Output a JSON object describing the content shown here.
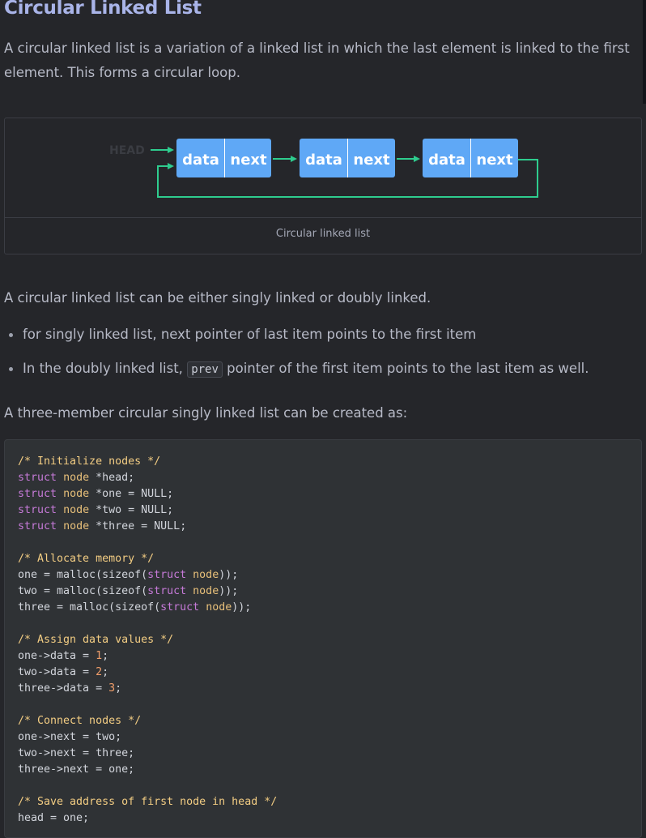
{
  "article": {
    "title": "Circular Linked List",
    "intro": "A circular linked list is a variation of a linked list in which the last element is linked to the first element. This forms a circular loop.",
    "figure": {
      "head_label": "HEAD",
      "nodes": [
        {
          "data": "data",
          "next": "next"
        },
        {
          "data": "data",
          "next": "next"
        },
        {
          "data": "data",
          "next": "next"
        }
      ],
      "caption": "Circular linked list"
    },
    "either_text": "A circular linked list can be either singly linked or doubly linked.",
    "bullets": {
      "b1": "for singly linked list, next pointer of last item points to the first item",
      "b2_before": "In the doubly linked list, ",
      "b2_code": "prev",
      "b2_after": " pointer of the first item points to the last item as well."
    },
    "create_text": "A three-member circular singly linked list can be created as:",
    "code": {
      "c1": "/* Initialize nodes */",
      "l1": {
        "kw": "struct",
        "ty": "node",
        "rest": " *head;"
      },
      "l2": {
        "kw": "struct",
        "ty": "node",
        "rest": " *one = ",
        "nul": "NULL",
        "end": ";"
      },
      "l3": {
        "kw": "struct",
        "ty": "node",
        "rest": " *two = ",
        "nul": "NULL",
        "end": ";"
      },
      "l4": {
        "kw": "struct",
        "ty": "node",
        "rest": " *three = ",
        "nul": "NULL",
        "end": ";"
      },
      "c2": "/* Allocate memory */",
      "m1": {
        "pre": "one = malloc(sizeof(",
        "kw": "struct",
        "ty": "node",
        "end": "));"
      },
      "m2": {
        "pre": "two = malloc(sizeof(",
        "kw": "struct",
        "ty": "node",
        "end": "));"
      },
      "m3": {
        "pre": "three = malloc(sizeof(",
        "kw": "struct",
        "ty": "node",
        "end": "));"
      },
      "c3": "/* Assign data values */",
      "d1": {
        "pre": "one->data = ",
        "num": "1",
        "end": ";"
      },
      "d2": {
        "pre": "two->data = ",
        "num": "2",
        "end": ";"
      },
      "d3": {
        "pre": "three->data = ",
        "num": "3",
        "end": ";"
      },
      "c4": "/* Connect nodes */",
      "n1": "one->next = two;",
      "n2": "two->next = three;",
      "n3": "three->next = one;",
      "c5": "/* Save address of first node in head */",
      "h1": "head = one;"
    }
  },
  "colors": {
    "background": "#25262a",
    "title": "#a9b4e8",
    "node_fill": "#5fa8f6",
    "arrow": "#2ecc8e"
  }
}
